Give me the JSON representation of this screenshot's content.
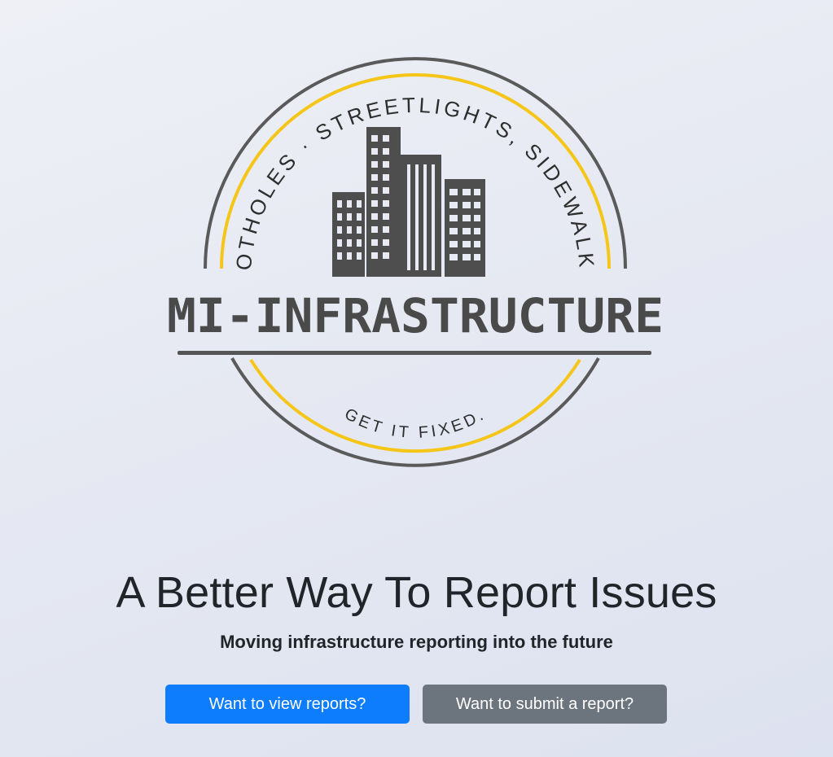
{
  "logo": {
    "arc_top_text": "POTHOLES · STREETLIGHTS, SIDEWALKS",
    "brand_text": "MI-INFRASTRUCTURE",
    "arc_bottom_text": "GET IT FIXED.",
    "colors": {
      "outline": "#555555",
      "accent": "#f5c518"
    }
  },
  "hero": {
    "headline": "A Better Way To Report Issues",
    "subheadline": "Moving infrastructure reporting into the future"
  },
  "actions": {
    "view_reports_label": "Want to view reports?",
    "submit_report_label": "Want to submit a report?"
  },
  "colors": {
    "primary": "#0d7dfd",
    "secondary": "#6c757d"
  }
}
